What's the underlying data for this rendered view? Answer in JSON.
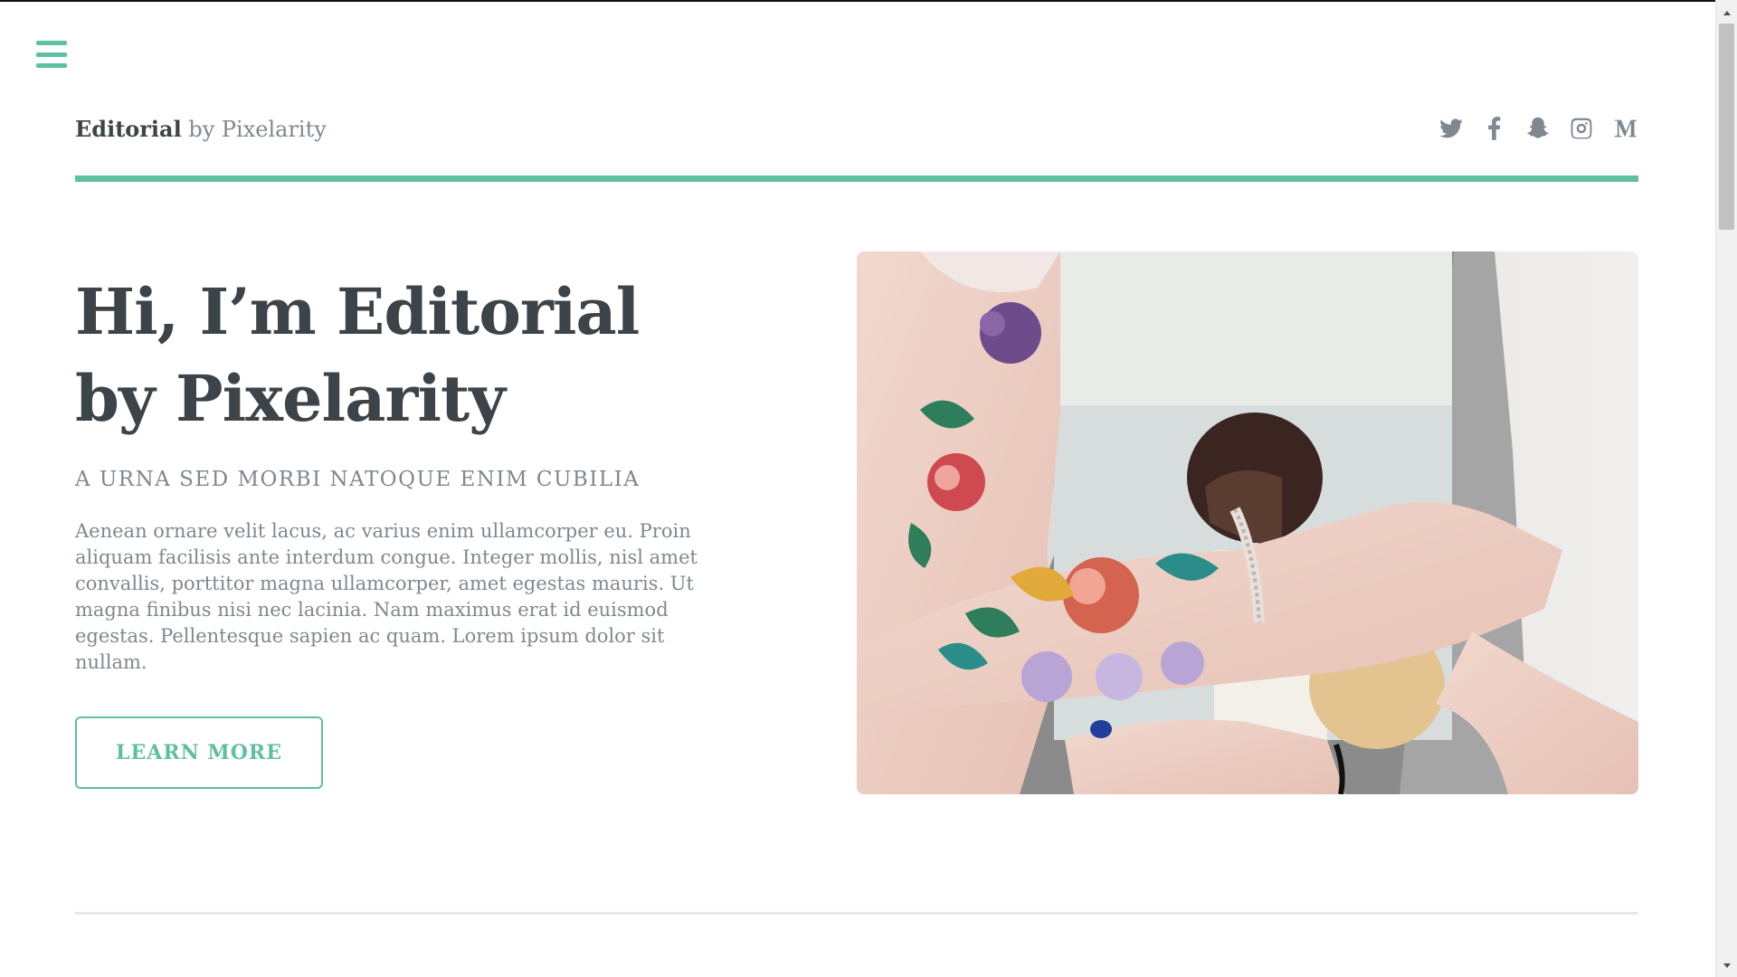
{
  "header": {
    "logo_strong": "Editorial",
    "logo_rest": " by Pixelarity",
    "social_icons": [
      "twitter-icon",
      "facebook-icon",
      "snapchat-icon",
      "instagram-icon",
      "medium-icon"
    ]
  },
  "hero": {
    "title": "Hi, I’m Editorial by Pixelarity",
    "subtitle": "A URNA SED MORBI NATOQUE ENIM CUBILIA",
    "body": "Aenean ornare velit lacus, ac varius enim ullamcorper eu. Proin aliquam facilisis ante interdum congue. Integer mollis, nisl amet convallis, porttitor magna ullamcorper, amet egestas mauris. Ut magna finibus nisi nec lacinia. Nam maximus erat id euismod egestas. Pellentesque sapien ac quam. Lorem ipsum dolor sit nullam.",
    "button_label": "LEARN MORE"
  },
  "colors": {
    "accent": "#5fbfa4",
    "heading": "#3d4449",
    "text": "#7f888f"
  }
}
